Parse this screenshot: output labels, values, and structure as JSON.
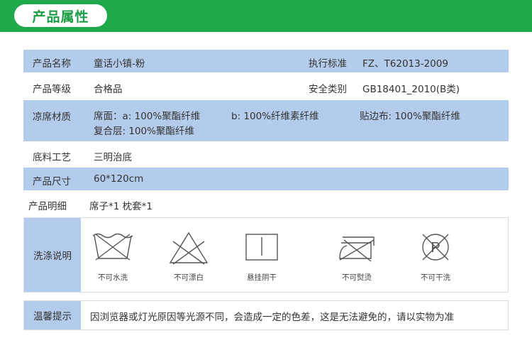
{
  "header": {
    "title": "产品属性"
  },
  "attributes": {
    "name": {
      "label": "产品名称",
      "value": "童话小镇-粉"
    },
    "standard": {
      "label": "执行标准",
      "value": "FZ、T62013-2009"
    },
    "grade": {
      "label": "产品等级",
      "value": "合格品"
    },
    "safety": {
      "label": "安全类别",
      "value": "GB18401_2010(B类)"
    },
    "material": {
      "label": "凉席材质",
      "surface": "席面：a: 100%聚酯纤维",
      "b": "b: 100%纤维素纤维",
      "edging": "贴边布: 100%聚酯纤维",
      "composite": "复合层: 100%聚酯纤维"
    },
    "craft": {
      "label": "底料工艺",
      "value": "三明治底"
    },
    "size": {
      "label": "产品尺寸",
      "value": "60*120cm"
    },
    "details": {
      "label": "产品明细",
      "value": "席子*1  枕套*1"
    }
  },
  "wash": {
    "label": "洗涤说明",
    "icons": [
      {
        "icon": "no-wash-icon",
        "caption": "不可水洗"
      },
      {
        "icon": "no-bleach-icon",
        "caption": "不可漂白"
      },
      {
        "icon": "hang-dry-shade-icon",
        "caption": "悬挂阴干"
      },
      {
        "icon": "no-iron-icon",
        "caption": "不可熨烫"
      },
      {
        "icon": "no-dry-clean-icon",
        "caption": "不可干洗"
      }
    ]
  },
  "notice": {
    "label": "温馨提示",
    "text": "因浏览器或灯光原因等光源不同，会造成一定的色差，这是无法避免的，请以实物为准"
  },
  "colors": {
    "brand_green": "#1fa94a",
    "row_blue": "#b4cceb"
  }
}
